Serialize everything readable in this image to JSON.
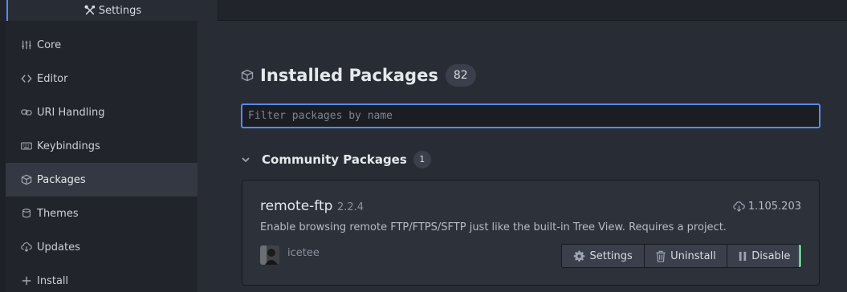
{
  "tab": {
    "label": "Settings",
    "icon": "tools-icon"
  },
  "sidebar": {
    "items": [
      {
        "label": "Core",
        "icon": "sliders-icon"
      },
      {
        "label": "Editor",
        "icon": "code-icon"
      },
      {
        "label": "URI Handling",
        "icon": "link-icon"
      },
      {
        "label": "Keybindings",
        "icon": "keyboard-icon"
      },
      {
        "label": "Packages",
        "icon": "package-icon",
        "active": true
      },
      {
        "label": "Themes",
        "icon": "paintcan-icon"
      },
      {
        "label": "Updates",
        "icon": "cloud-download-icon"
      },
      {
        "label": "Install",
        "icon": "plus-icon"
      }
    ]
  },
  "main": {
    "title": "Installed Packages",
    "count": "82",
    "filter": {
      "placeholder": "Filter packages by name",
      "value": ""
    },
    "community": {
      "title": "Community Packages",
      "count": "1"
    }
  },
  "package": {
    "name": "remote-ftp",
    "version": "2.2.4",
    "downloads": "1.105.203",
    "description": "Enable browsing remote FTP/FTPS/SFTP just like the built-in Tree View. Requires a project.",
    "author": "icetee",
    "buttons": {
      "settings": "Settings",
      "uninstall": "Uninstall",
      "disable": "Disable"
    }
  },
  "colors": {
    "accent": "#568af2",
    "enabled_indicator": "#73c990"
  }
}
